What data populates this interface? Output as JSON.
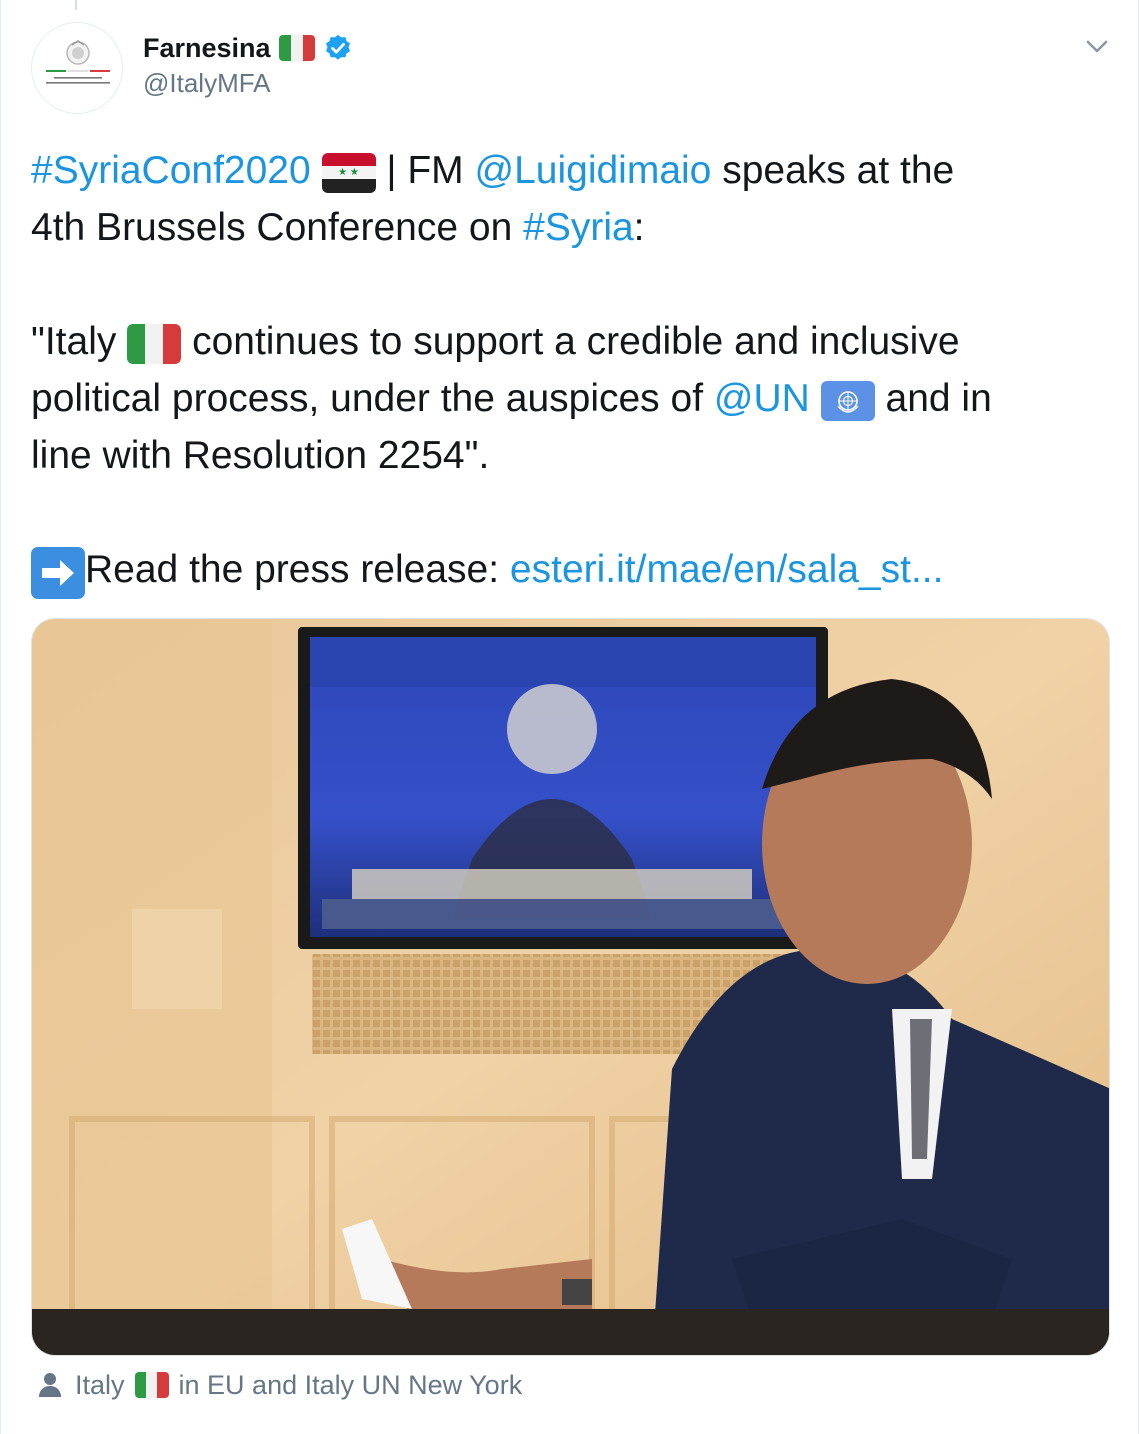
{
  "account": {
    "display_name": "Farnesina",
    "handle": "@ItalyMFA",
    "avatar_caption_line1": "Ministero degli Affari Esteri",
    "avatar_caption_line2": "e della Cooperazione Internazionale"
  },
  "tweet": {
    "line1": {
      "hashtag": "#SyriaConf2020",
      "separator": "| FM",
      "mention": "@Luigidimaio",
      "rest": "speaks at the"
    },
    "line2": {
      "text": "4th Brussels Conference on",
      "hashtag": "#Syria",
      "colon": ":"
    },
    "quote_line1": {
      "start": "\"Italy",
      "rest": "continues to support a credible and inclusive"
    },
    "quote_line2": {
      "text": "political process, under the auspices of",
      "mention": "@UN",
      "rest": "and in"
    },
    "quote_line3": "line with Resolution 2254\".",
    "read_more": {
      "label": "Read the press release:",
      "link": "esteri.it/mae/en/sala_st..."
    }
  },
  "tagged": {
    "start": "Italy",
    "rest": "in EU and Italy UN New York"
  },
  "icons": {
    "verified": "verified-badge-icon",
    "more": "chevron-down-icon",
    "person": "person-icon",
    "arrow": "right-arrow-icon"
  },
  "colors": {
    "link": "#1b95e0",
    "secondary_text": "#657786",
    "verified": "#1da1f2"
  }
}
